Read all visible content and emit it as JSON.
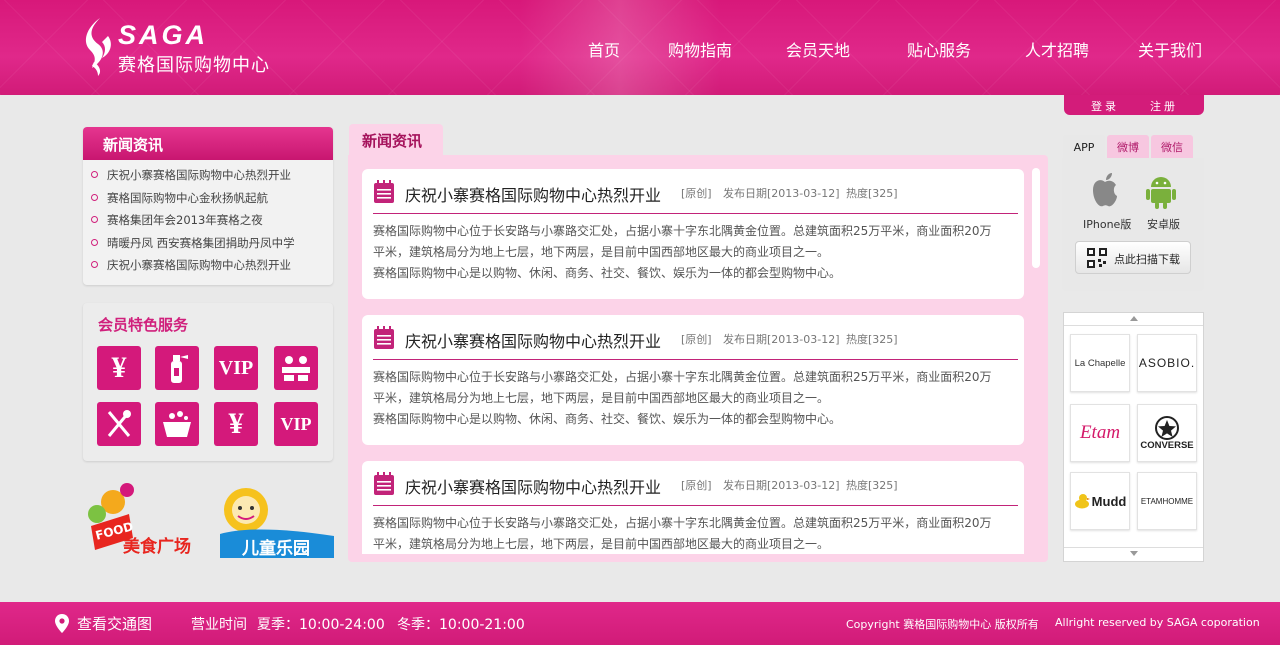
{
  "logo": {
    "en": "SAGA",
    "cn": "赛格国际购物中心"
  },
  "nav": [
    {
      "label": "首页"
    },
    {
      "label": "购物指南"
    },
    {
      "label": "会员天地"
    },
    {
      "label": "贴心服务"
    },
    {
      "label": "人才招聘"
    },
    {
      "label": "关于我们"
    }
  ],
  "auth": {
    "login": "登录",
    "register": "注册"
  },
  "sidebar_news": {
    "title": "新闻资讯",
    "items": [
      "庆祝小寨赛格国际购物中心热烈开业",
      "赛格国际购物中心金秋扬帆起航",
      "赛格集团年会2013年赛格之夜",
      "晴暖丹凤 西安赛格集团捐助丹凤中学",
      "庆祝小寨赛格国际购物中心热烈开业"
    ]
  },
  "member": {
    "title": "会员特色服务",
    "icons": [
      {
        "name": "yen",
        "glyph": "¥"
      },
      {
        "name": "fire-extinguisher",
        "glyph": "🧯"
      },
      {
        "name": "vip",
        "glyph": "VIP"
      },
      {
        "name": "lounge",
        "glyph": "⛁"
      },
      {
        "name": "dining",
        "glyph": "🍴"
      },
      {
        "name": "gift-basket",
        "glyph": "☸"
      },
      {
        "name": "yen",
        "glyph": "¥"
      },
      {
        "name": "vip",
        "glyph": "VIP"
      }
    ]
  },
  "promos": {
    "food": "美食广场",
    "food_en": "FOOD",
    "kids": "儿童乐园"
  },
  "main": {
    "tab": "新闻资讯",
    "articles": [
      {
        "title": "庆祝小寨赛格国际购物中心热烈开业",
        "source": "[原创]",
        "date": "发布日期[2013-03-12]",
        "heat": "热度[325]",
        "body": [
          "赛格国际购物中心位于长安路与小寨路交汇处，占据小寨十字东北隅黄金位置。总建筑面积25万平米，商业面积20万",
          "平米，建筑格局分为地上七层，地下两层，是目前中国西部地区最大的商业项目之一。",
          "赛格国际购物中心是以购物、休闲、商务、社交、餐饮、娱乐为一体的都会型购物中心。"
        ]
      },
      {
        "title": "庆祝小寨赛格国际购物中心热烈开业",
        "source": "[原创]",
        "date": "发布日期[2013-03-12]",
        "heat": "热度[325]",
        "body": [
          "赛格国际购物中心位于长安路与小寨路交汇处，占据小寨十字东北隅黄金位置。总建筑面积25万平米，商业面积20万",
          "平米，建筑格局分为地上七层，地下两层，是目前中国西部地区最大的商业项目之一。",
          "赛格国际购物中心是以购物、休闲、商务、社交、餐饮、娱乐为一体的都会型购物中心。"
        ]
      },
      {
        "title": "庆祝小寨赛格国际购物中心热烈开业",
        "source": "[原创]",
        "date": "发布日期[2013-03-12]",
        "heat": "热度[325]",
        "body": [
          "赛格国际购物中心位于长安路与小寨路交汇处，占据小寨十字东北隅黄金位置。总建筑面积25万平米，商业面积20万",
          "平米，建筑格局分为地上七层，地下两层，是目前中国西部地区最大的商业项目之一。"
        ]
      }
    ]
  },
  "app": {
    "tabs": [
      "APP",
      "微博",
      "微信"
    ],
    "iphone": "IPhone版",
    "android": "安卓版",
    "qr_button": "点此扫描下载"
  },
  "brands": [
    "La Chapelle",
    "ASOBIO.",
    "Etam",
    "CONVERSE",
    "Mudd",
    "ETAMHOMME"
  ],
  "footer": {
    "traffic": "查看交通图",
    "hours_label": "营业时间",
    "summer": "夏季：10:00-24:00",
    "winter": "冬季：10:00-21:00",
    "copyright": "Copyright 赛格国际购物中心 版权所有",
    "rights": "Allright reserved by SAGA coporation"
  },
  "colors": {
    "brand_pink": "#d4197b",
    "panel_pink": "#fcd3e8",
    "footer": "#d11b78"
  }
}
